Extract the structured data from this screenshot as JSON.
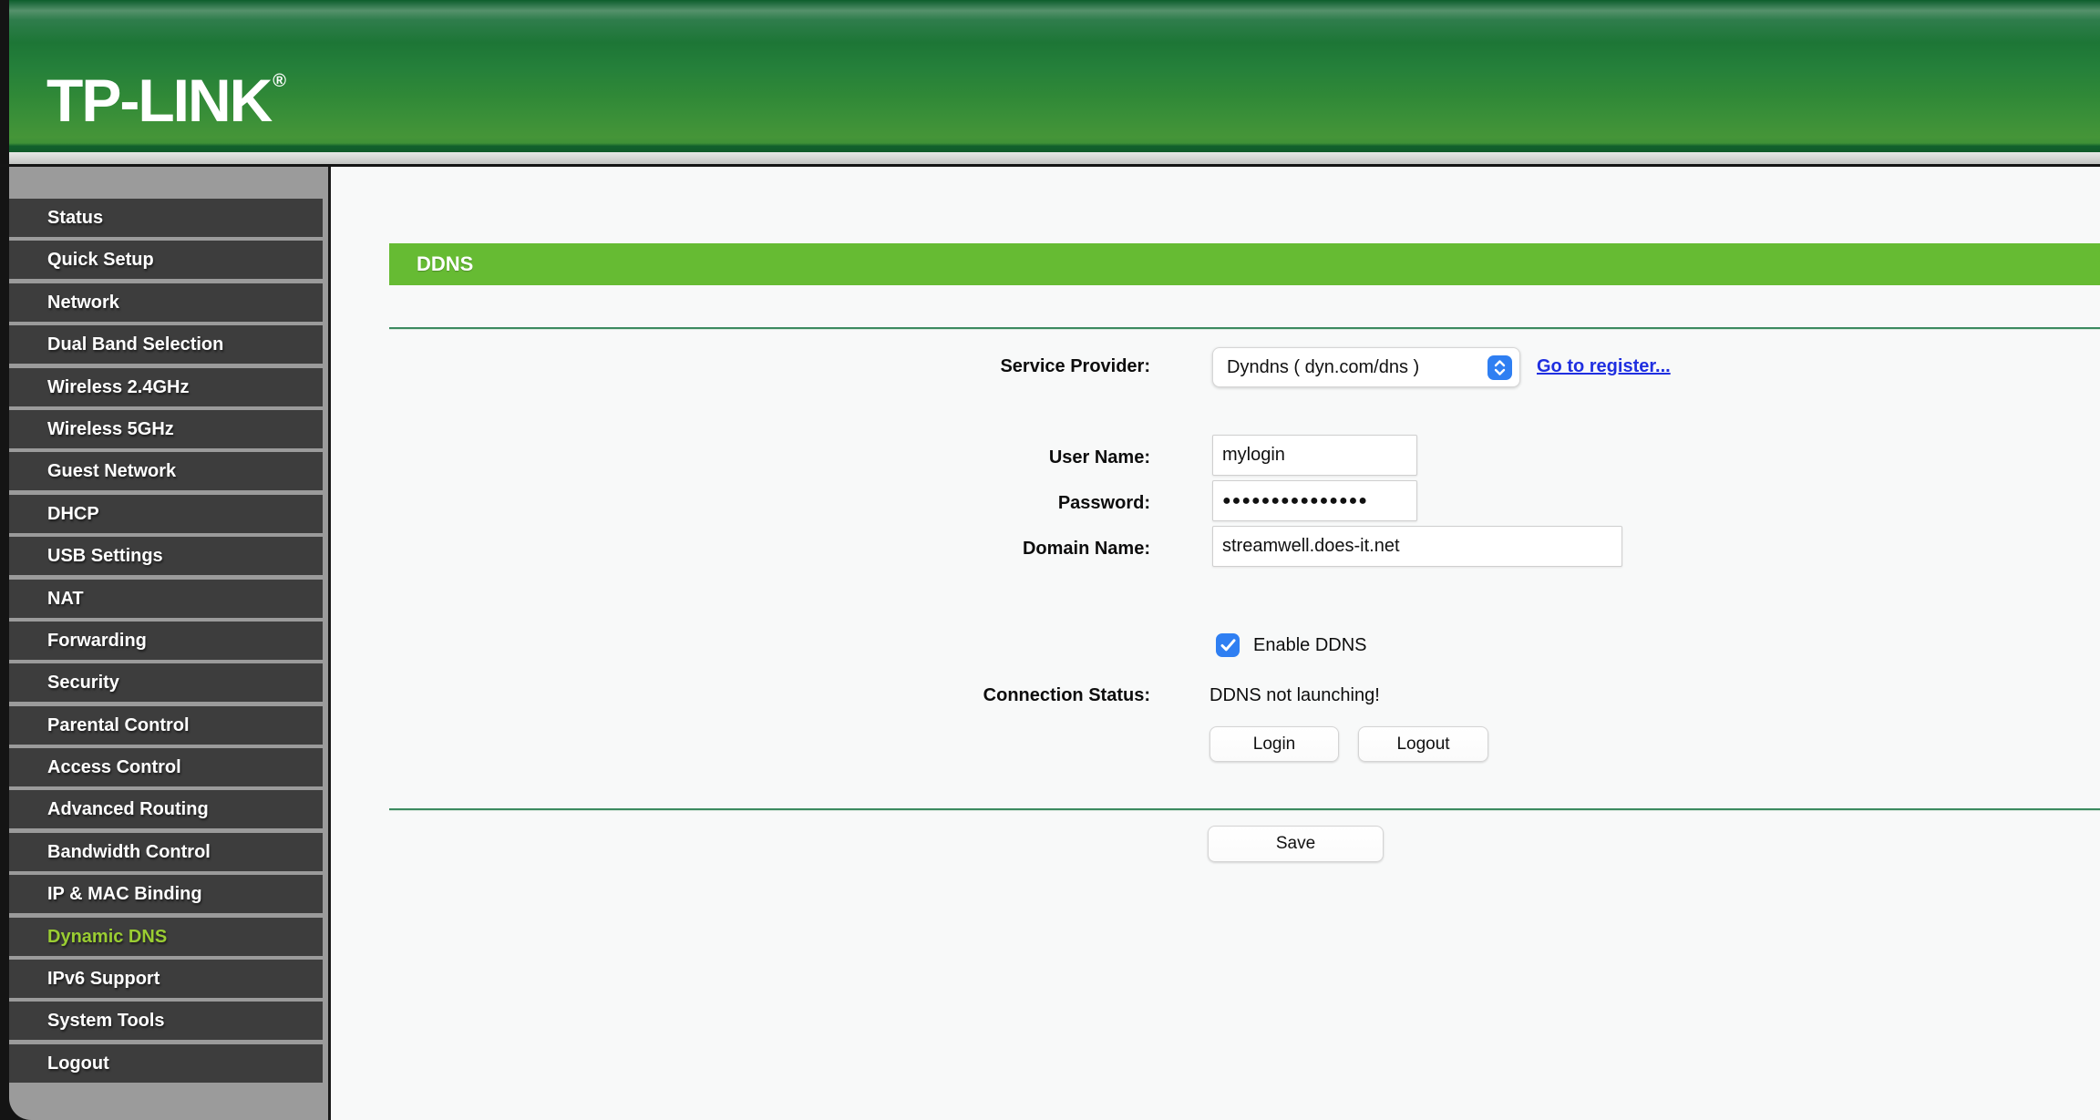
{
  "brand": {
    "logo_text": "TP-LINK",
    "registered_mark": "®"
  },
  "sidebar": {
    "items": [
      {
        "id": "status",
        "label": "Status",
        "active": false
      },
      {
        "id": "quick-setup",
        "label": "Quick Setup",
        "active": false
      },
      {
        "id": "network",
        "label": "Network",
        "active": false
      },
      {
        "id": "dual-band-selection",
        "label": "Dual Band Selection",
        "active": false
      },
      {
        "id": "wireless-24ghz",
        "label": "Wireless 2.4GHz",
        "active": false
      },
      {
        "id": "wireless-5ghz",
        "label": "Wireless 5GHz",
        "active": false
      },
      {
        "id": "guest-network",
        "label": "Guest Network",
        "active": false
      },
      {
        "id": "dhcp",
        "label": "DHCP",
        "active": false
      },
      {
        "id": "usb-settings",
        "label": "USB Settings",
        "active": false
      },
      {
        "id": "nat",
        "label": "NAT",
        "active": false
      },
      {
        "id": "forwarding",
        "label": "Forwarding",
        "active": false
      },
      {
        "id": "security",
        "label": "Security",
        "active": false
      },
      {
        "id": "parental-control",
        "label": "Parental Control",
        "active": false
      },
      {
        "id": "access-control",
        "label": "Access Control",
        "active": false
      },
      {
        "id": "advanced-routing",
        "label": "Advanced Routing",
        "active": false
      },
      {
        "id": "bandwidth-control",
        "label": "Bandwidth Control",
        "active": false
      },
      {
        "id": "ip-mac-binding",
        "label": "IP & MAC Binding",
        "active": false
      },
      {
        "id": "dynamic-dns",
        "label": "Dynamic DNS",
        "active": true
      },
      {
        "id": "ipv6-support",
        "label": "IPv6 Support",
        "active": false
      },
      {
        "id": "system-tools",
        "label": "System Tools",
        "active": false
      },
      {
        "id": "logout",
        "label": "Logout",
        "active": false
      }
    ]
  },
  "page": {
    "title": "DDNS"
  },
  "form": {
    "service_provider": {
      "label": "Service Provider:",
      "selected_option": "Dyndns ( dyn.com/dns )",
      "register_link": "Go to register..."
    },
    "user_name": {
      "label": "User Name:",
      "value": "mylogin"
    },
    "password": {
      "label": "Password:",
      "value": "●●●●●●●●●●●●●●●"
    },
    "domain_name": {
      "label": "Domain Name:",
      "value": "streamwell.does-it.net"
    },
    "enable_ddns": {
      "label": "Enable DDNS",
      "checked": true
    },
    "connection_status": {
      "label": "Connection Status:",
      "value": "DDNS not launching!"
    },
    "actions": {
      "login": "Login",
      "logout": "Logout",
      "save": "Save"
    }
  },
  "colors": {
    "accent_green": "#66bb33",
    "active_item_green": "#9acd32",
    "divider_green": "#3c8a60",
    "accent_blue": "#2f7ff2",
    "link_blue": "#1f2fe0"
  }
}
